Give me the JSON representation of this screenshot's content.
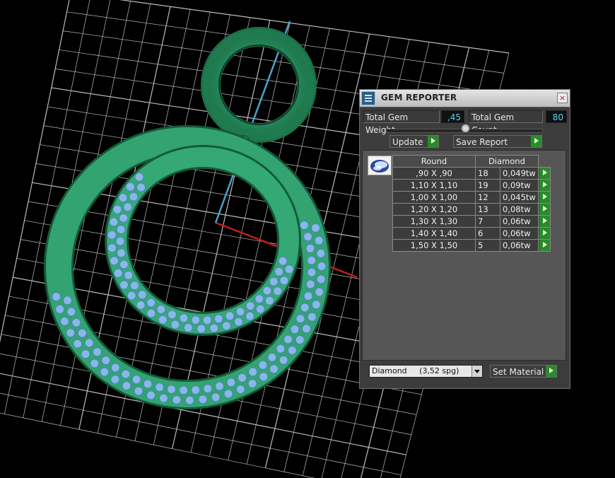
{
  "panel": {
    "title": "GEM REPORTER",
    "close_glyph": "×",
    "total_weight_label": "Total Gem Weight",
    "total_weight_value": ",45",
    "total_count_label": "Total Gem Count",
    "total_count_value": "80",
    "update_label": "Update",
    "save_report_label": "Save Report",
    "table": {
      "headers": [
        "Round",
        "Diamond"
      ],
      "rows": [
        {
          "size": ",90 X ,90",
          "count": "18",
          "weight": "0,049tw"
        },
        {
          "size": "1,10 X 1,10",
          "count": "19",
          "weight": "0,09tw"
        },
        {
          "size": "1,00 X 1,00",
          "count": "12",
          "weight": "0,045tw"
        },
        {
          "size": "1,20 X 1,20",
          "count": "13",
          "weight": "0,08tw"
        },
        {
          "size": "1,30 X 1,30",
          "count": "7",
          "weight": "0,06tw"
        },
        {
          "size": "1,40 X 1,40",
          "count": "6",
          "weight": "0,06tw"
        },
        {
          "size": "1,50 X 1,50",
          "count": "5",
          "weight": "0,06tw"
        }
      ]
    },
    "material_select": "Diamond     (3,52 spg)",
    "set_material_label": "Set Material"
  },
  "colors": {
    "grid": "#bdbdbd",
    "axis_red": "#c0201c",
    "axis_blue": "#4aa3cc",
    "metal_green": "#2f9e6a",
    "gem_blue": "#86b8e8",
    "value_text": "#5fd0f4",
    "arrow_green": "#2b8a2b"
  }
}
